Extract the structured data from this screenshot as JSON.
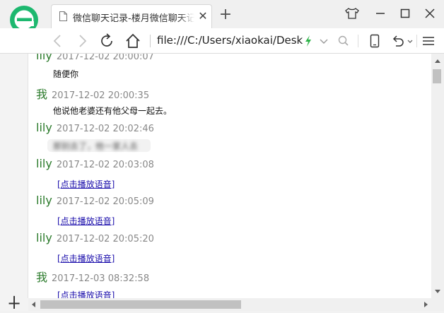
{
  "tab": {
    "title": "微信聊天记录-楼月微信聊天记录",
    "close": "✕"
  },
  "newtab_label": "+",
  "address": "file:///C:/Users/xiaokai/Deskt",
  "messages": [
    {
      "sender": "lily",
      "time": "2017-12-02 20:00:07",
      "text": "随便你"
    },
    {
      "sender": "我",
      "time": "2017-12-02 20:00:35",
      "text": "他说他老婆还有他父母一起去。"
    },
    {
      "sender": "lily",
      "time": "2017-12-02 20:02:46",
      "blurred": "那别去了，他一家人去"
    },
    {
      "sender": "lily",
      "time": "2017-12-02 20:03:08",
      "link": "[点击播放语音]"
    },
    {
      "sender": "lily",
      "time": "2017-12-02 20:05:09",
      "link": "[点击播放语音]"
    },
    {
      "sender": "lily",
      "time": "2017-12-02 20:05:20",
      "link": "[点击播放语音]"
    },
    {
      "sender": "我",
      "time": "2017-12-03 08:32:58",
      "link": "[点击播放语音]"
    }
  ],
  "sidebar": {
    "add_label": "+"
  },
  "colors": {
    "brand": "#1db86f",
    "sender": "#2a7a2a",
    "link": "#1a0dab",
    "bolt": "#2fb44a"
  }
}
